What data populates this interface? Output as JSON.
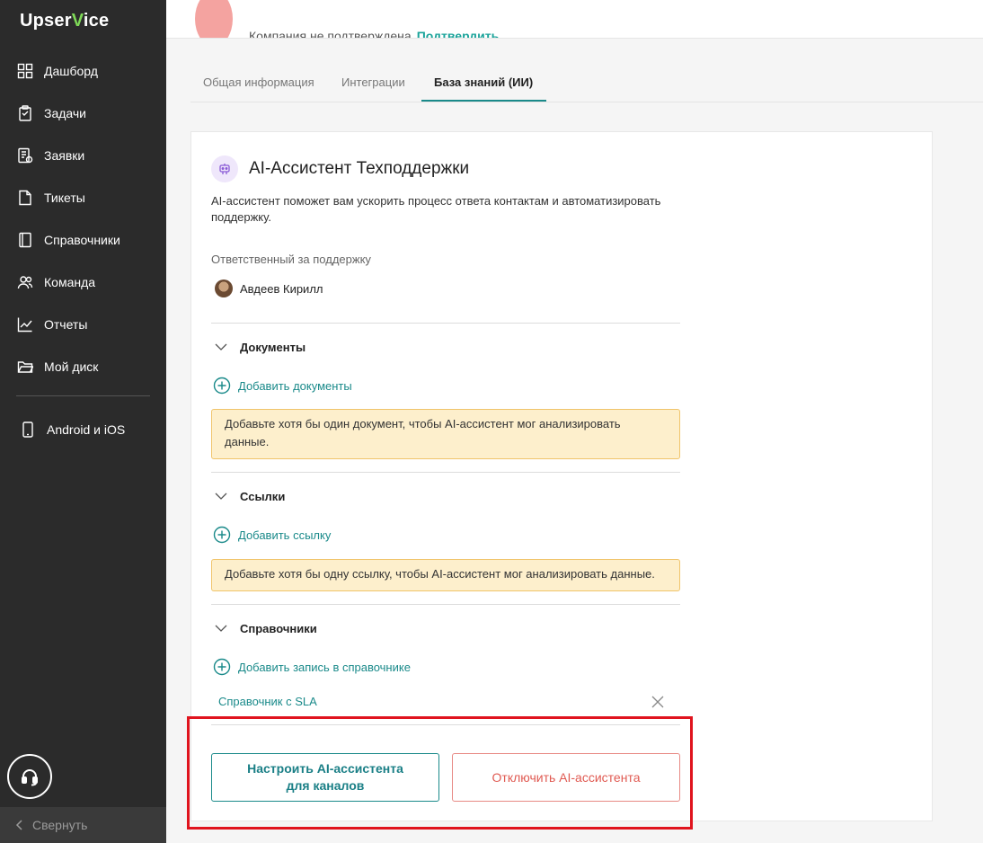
{
  "app": {
    "logo_prefix": "Upser",
    "logo_accent": "V",
    "logo_suffix": "ice"
  },
  "sidebar": {
    "items": [
      {
        "label": "Дашборд",
        "icon": "dashboard-icon"
      },
      {
        "label": "Задачи",
        "icon": "tasks-icon"
      },
      {
        "label": "Заявки",
        "icon": "requests-icon"
      },
      {
        "label": "Тикеты",
        "icon": "tickets-icon"
      },
      {
        "label": "Справочники",
        "icon": "directories-icon"
      },
      {
        "label": "Команда",
        "icon": "team-icon"
      },
      {
        "label": "Отчеты",
        "icon": "reports-icon"
      },
      {
        "label": "Мой диск",
        "icon": "folder-icon"
      }
    ],
    "mobile_label": "Android и iOS",
    "collapse_label": "Свернуть"
  },
  "header": {
    "company_status": "Компания не подтверждена",
    "confirm_link": "Подтвердить"
  },
  "tabs": [
    {
      "label": "Общая информация",
      "active": false
    },
    {
      "label": "Интеграции",
      "active": false
    },
    {
      "label": "База знаний (ИИ)",
      "active": true
    }
  ],
  "card": {
    "title": "AI-Ассистент Техподдержки",
    "description": "AI-ассистент поможет вам ускорить процесс ответа контактам и автоматизировать поддержку.",
    "responsible_label": "Ответственный за поддержку",
    "responsible_name": "Авдеев Кирилл",
    "sections": {
      "documents": {
        "title": "Документы",
        "add_label": "Добавить документы",
        "warning": "Добавьте хотя бы один документ, чтобы AI-ассистент мог анализировать данные."
      },
      "links": {
        "title": "Ссылки",
        "add_label": "Добавить ссылку",
        "warning": "Добавьте хотя бы одну ссылку, чтобы AI-ассистент мог анализировать данные."
      },
      "directories": {
        "title": "Справочники",
        "add_label": "Добавить запись в справочнике",
        "entries": [
          "Справочник с SLA"
        ]
      }
    },
    "buttons": {
      "setup": "Настроить AI-ассистента для каналов",
      "disable": "Отключить AI-ассистента"
    }
  },
  "colors": {
    "accent": "#1a8a8a",
    "danger": "#e05a52",
    "warning_bg": "#fdefcc",
    "highlight": "#e0141e"
  }
}
